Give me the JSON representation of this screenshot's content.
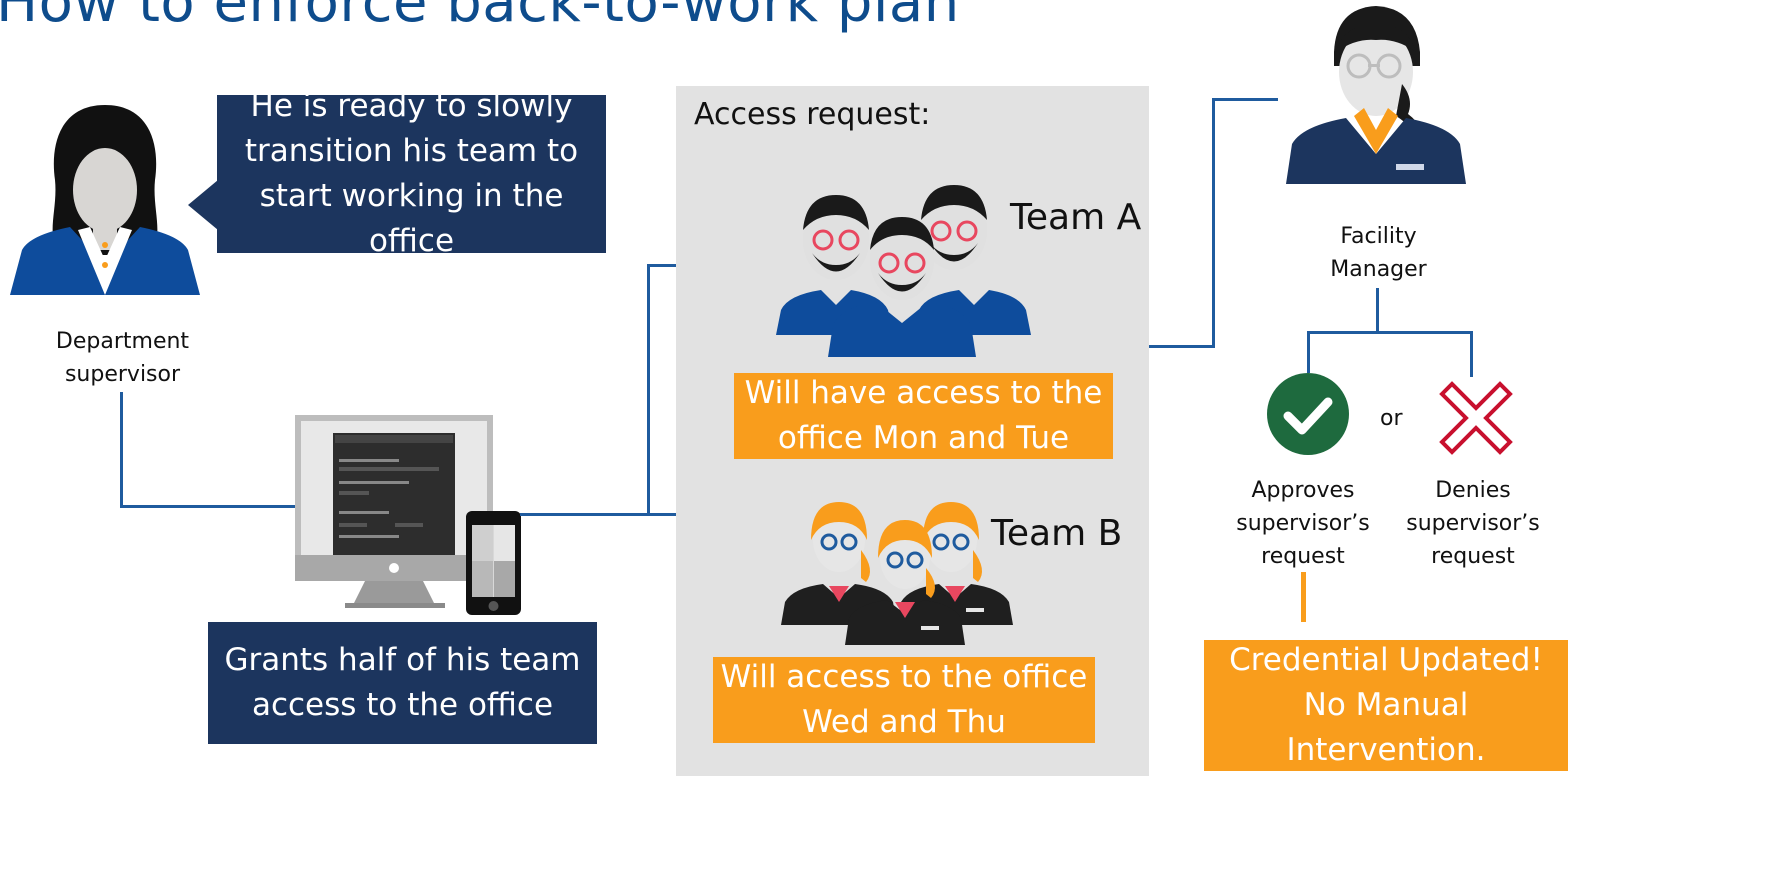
{
  "title": "How to enforce back-to-work plan",
  "supervisor": {
    "speech": [
      "He is ready to slowly",
      "transition his team to",
      "start working in the office"
    ],
    "caption": [
      "Department",
      "supervisor"
    ]
  },
  "device": {
    "action": [
      "Grants half of his team",
      "access to the office"
    ]
  },
  "access_request": {
    "heading": "Access request:",
    "team_a": {
      "name": "Team A",
      "access": [
        "Will have access to the",
        "office Mon and Tue"
      ]
    },
    "team_b": {
      "name": "Team B",
      "access": [
        "Will access to the office",
        "Wed and Thu"
      ]
    }
  },
  "facility_manager": {
    "caption": [
      "Facility",
      "Manager"
    ],
    "or_text": "or",
    "approve": [
      "Approves",
      "supervisor’s",
      "request"
    ],
    "deny": [
      "Denies",
      "supervisor’s",
      "request"
    ],
    "result": [
      "Credential Updated!",
      "No Manual Intervention."
    ]
  },
  "colors": {
    "navy": "#1c355e",
    "orange": "#f99d1c",
    "connector": "#1f5b9e",
    "approve_green": "#1e6a3e",
    "deny_red": "#c8102e",
    "panel_gray": "#e2e2e2"
  }
}
